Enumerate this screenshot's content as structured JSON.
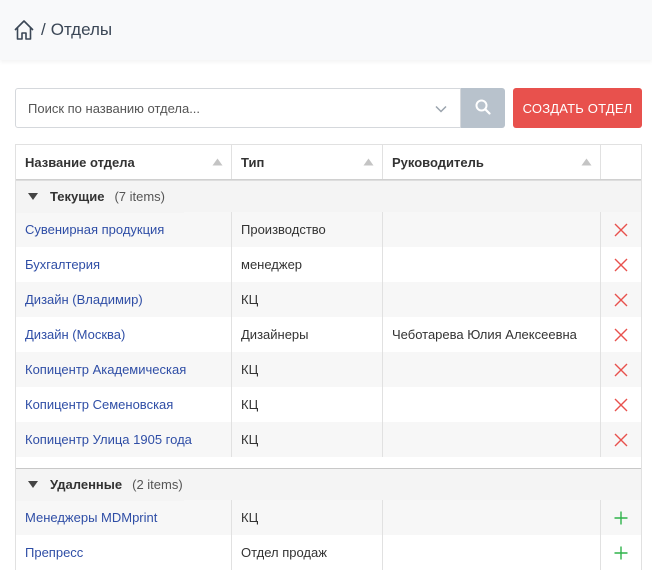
{
  "breadcrumb": {
    "separator": "/",
    "title": "Отделы"
  },
  "search": {
    "placeholder": "Поиск по названию отдела..."
  },
  "toolbar": {
    "create_label": "СОЗДАТЬ ОТДЕЛ"
  },
  "colors": {
    "accent_red": "#e8514d",
    "link": "#2f4ea6",
    "add_green": "#2fb34a",
    "search_btn": "#b8c2cc"
  },
  "table": {
    "columns": [
      "Название отдела",
      "Тип",
      "Руководитель"
    ],
    "groups": [
      {
        "name": "Текущие",
        "count": "(7 items)",
        "rows": [
          {
            "name": "Сувенирная продукция",
            "type": "Производство",
            "head": ""
          },
          {
            "name": "Бухгалтерия",
            "type": "менеджер",
            "head": ""
          },
          {
            "name": "Дизайн (Владимир)",
            "type": "КЦ",
            "head": ""
          },
          {
            "name": "Дизайн (Москва)",
            "type": "Дизайнеры",
            "head": "Чеботарева Юлия Алексеевна"
          },
          {
            "name": "Копицентр Академическая",
            "type": "КЦ",
            "head": ""
          },
          {
            "name": "Копицентр Семеновская",
            "type": "КЦ",
            "head": ""
          },
          {
            "name": "Копицентр Улица 1905 года",
            "type": "КЦ",
            "head": ""
          }
        ]
      },
      {
        "name": "Удаленные",
        "count": "(2 items)",
        "rows": [
          {
            "name": "Менеджеры MDMprint",
            "type": "КЦ",
            "head": ""
          },
          {
            "name": "Препресс",
            "type": "Отдел продаж",
            "head": ""
          }
        ]
      }
    ]
  }
}
